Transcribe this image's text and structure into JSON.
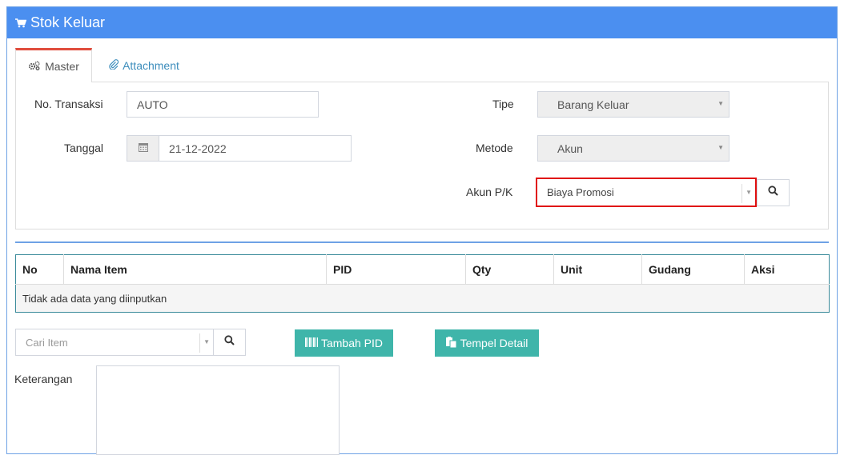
{
  "header": {
    "title": "Stok Keluar",
    "icon": "shopping-cart-icon"
  },
  "tabs": [
    {
      "label": "Master",
      "icon": "cogs-icon",
      "active": true
    },
    {
      "label": "Attachment",
      "icon": "paperclip-icon",
      "active": false
    }
  ],
  "form": {
    "no_transaksi": {
      "label": "No. Transaksi",
      "value": "AUTO"
    },
    "tanggal": {
      "label": "Tanggal",
      "value": "21-12-2022",
      "icon": "calendar-icon"
    },
    "tipe": {
      "label": "Tipe",
      "value": "Barang Keluar"
    },
    "metode": {
      "label": "Metode",
      "value": "Akun"
    },
    "akun_pk": {
      "label": "Akun P/K",
      "value": "Biaya Promosi"
    }
  },
  "table": {
    "columns": [
      "No",
      "Nama Item",
      "PID",
      "Qty",
      "Unit",
      "Gudang",
      "Aksi"
    ],
    "empty_message": "Tidak ada data yang diinputkan"
  },
  "item_search": {
    "placeholder": "Cari Item"
  },
  "buttons": {
    "tambah_pid": "Tambah PID",
    "tempel_detail": "Tempel Detail"
  },
  "keterangan": {
    "label": "Keterangan",
    "value": ""
  },
  "colors": {
    "header": "#4b8ff0",
    "accent_teal": "#3fb5aa",
    "active_tab_border": "#e04d3d",
    "highlight": "#e01010"
  }
}
